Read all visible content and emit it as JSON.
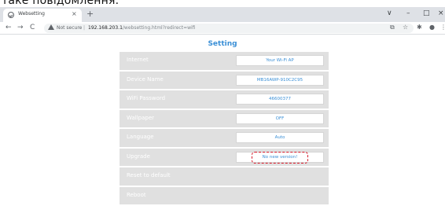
{
  "caption": {
    "text": "таке повідомлення."
  },
  "browser": {
    "tab_title": "Websetting",
    "tab_close": "×",
    "new_tab": "+",
    "window_controls": {
      "dropdown": "∨",
      "minimize": "–",
      "maximize": "□",
      "close": "×"
    },
    "nav": {
      "back": "←",
      "forward": "→",
      "reload": "C"
    },
    "security_text": "Not secure",
    "separator": "|",
    "url_host": "192.168.203.1",
    "url_path": "/websetting.html?redirect=wifi",
    "extensions": {
      "share": "⧉",
      "star": "☆",
      "puzzle": "✱",
      "profile": "●",
      "menu": "⋮"
    }
  },
  "page": {
    "title": "Setting",
    "rows": [
      {
        "label": "Internet",
        "value": "Your Wi-Fi AP"
      },
      {
        "label": "Device Name",
        "value": "MB16AWP-910C2C95"
      },
      {
        "label": "WiFi Password",
        "value": "46600377"
      },
      {
        "label": "Wallpaper",
        "value": "OFF"
      },
      {
        "label": "Language",
        "value": "Auto"
      },
      {
        "label": "Upgrade",
        "value": "No new version!"
      },
      {
        "label": "Reset to default"
      },
      {
        "label": "Reboot"
      }
    ]
  },
  "colors": {
    "accent": "#3a8fd6",
    "row_bg": "#e0e0e0",
    "highlight": "#d8192a"
  }
}
